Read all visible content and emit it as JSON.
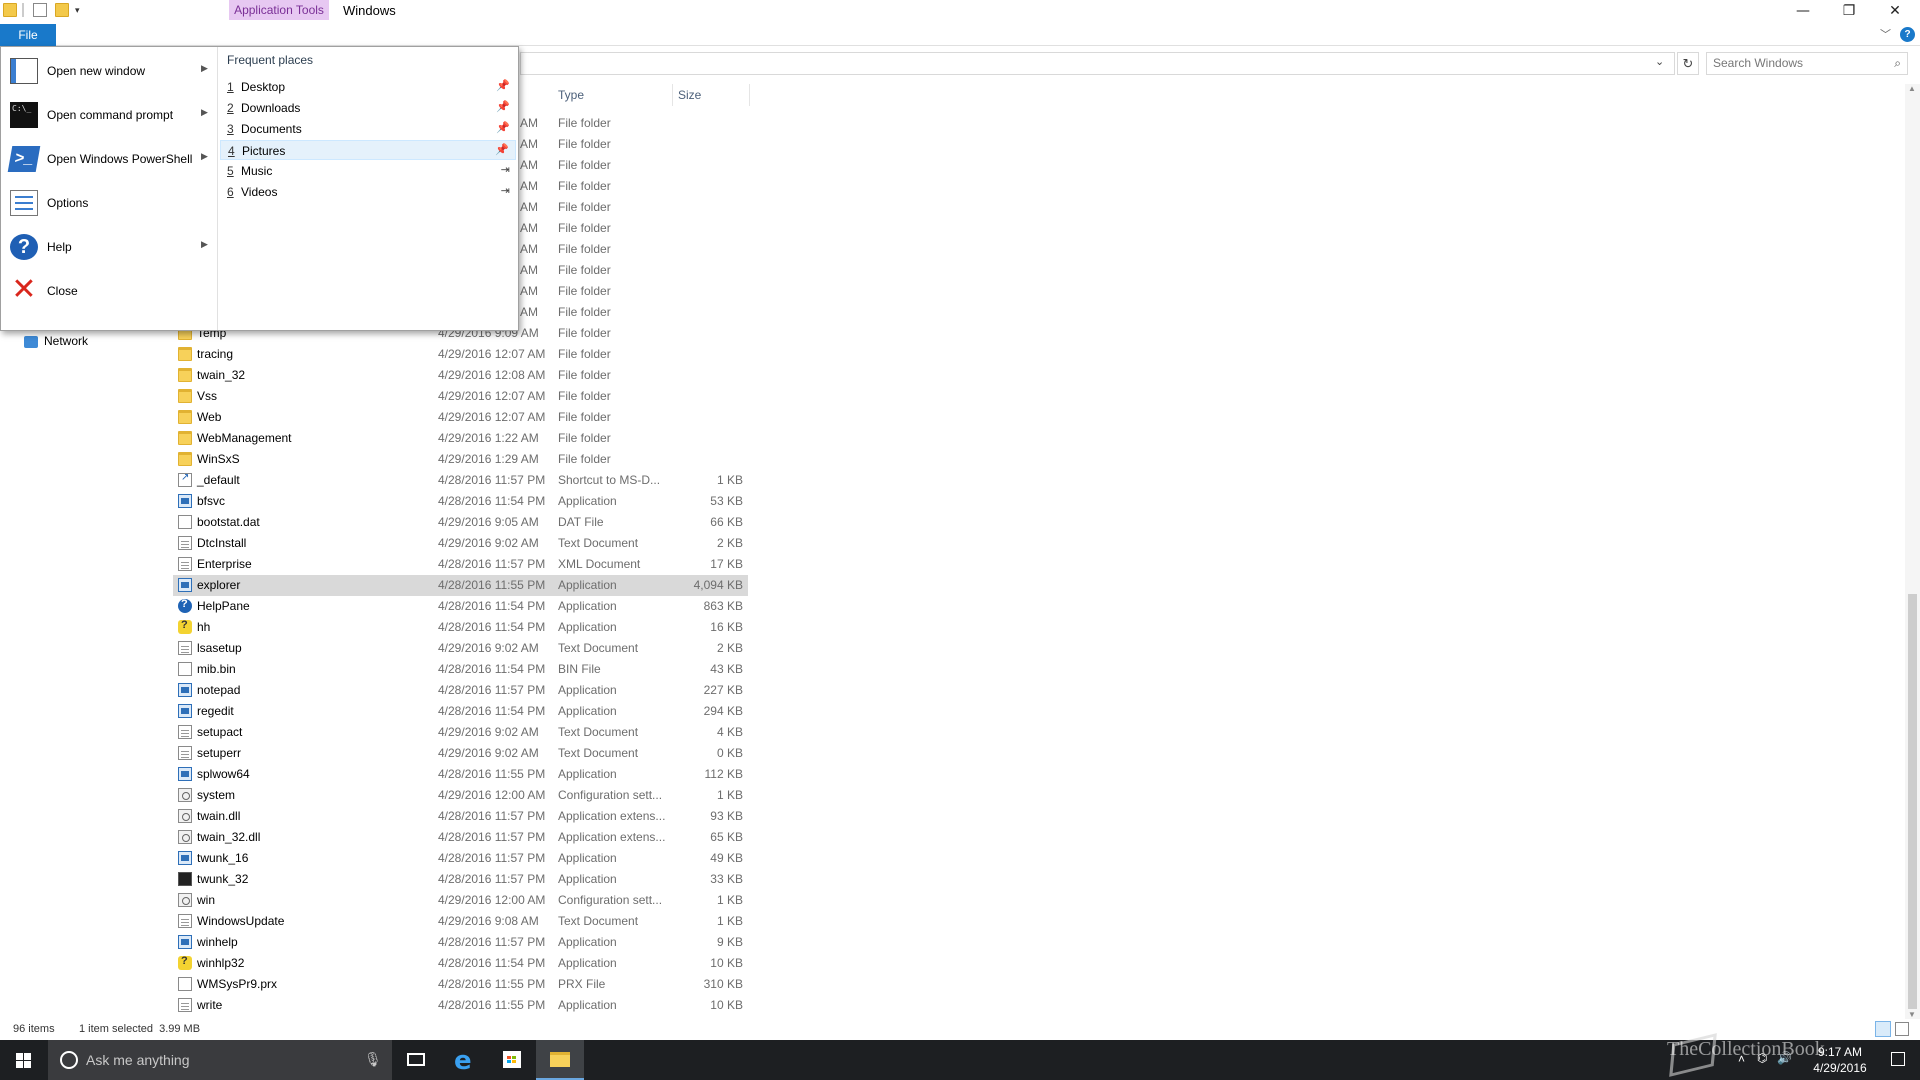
{
  "window": {
    "title": "Windows",
    "contextual_tab": "Application Tools",
    "minimize": "—",
    "maximize": "❐",
    "close": "✕"
  },
  "ribbon": {
    "file_tab": "File",
    "collapse": "﹀",
    "help": "?"
  },
  "address": {
    "search_placeholder": "Search Windows",
    "dropdown": "⌄",
    "refresh": "↻",
    "search_icon": "🔍"
  },
  "columns": {
    "type": "Type",
    "size": "Size"
  },
  "nav": {
    "network": "Network"
  },
  "file_menu": {
    "items": [
      {
        "label": "Open new window",
        "icon": "new-window-icon",
        "submenu": true
      },
      {
        "label": "Open command prompt",
        "icon": "command-prompt-icon",
        "submenu": true
      },
      {
        "label": "Open Windows PowerShell",
        "icon": "powershell-icon",
        "submenu": true
      },
      {
        "label": "Options",
        "icon": "options-icon",
        "submenu": false
      },
      {
        "label": "Help",
        "icon": "help-icon",
        "submenu": true
      },
      {
        "label": "Close",
        "icon": "close-icon",
        "submenu": false
      }
    ],
    "frequent_title": "Frequent places",
    "frequent": [
      {
        "num": "1",
        "label": "Desktop",
        "pinned": true
      },
      {
        "num": "2",
        "label": "Downloads",
        "pinned": true
      },
      {
        "num": "3",
        "label": "Documents",
        "pinned": true
      },
      {
        "num": "4",
        "label": "Pictures",
        "pinned": true
      },
      {
        "num": "5",
        "label": "Music",
        "pinned": false
      },
      {
        "num": "6",
        "label": "Videos",
        "pinned": false
      }
    ]
  },
  "hidden_rows": [
    {
      "date_tail": "AM",
      "type": "File folder"
    },
    {
      "date_tail": "AM",
      "type": "File folder"
    },
    {
      "date_tail": "AM",
      "type": "File folder"
    },
    {
      "date_tail": "AM",
      "type": "File folder"
    },
    {
      "date_tail": "AM",
      "type": "File folder"
    },
    {
      "date_tail": "AM",
      "type": "File folder"
    },
    {
      "date_tail": "AM",
      "type": "File folder"
    },
    {
      "date_tail": "AM",
      "type": "File folder"
    },
    {
      "date_tail": "AM",
      "type": "File folder"
    },
    {
      "date_tail": "AM",
      "type": "File folder"
    }
  ],
  "files": [
    {
      "name": "Temp",
      "date": "4/29/2016 9:09 AM",
      "type": "File folder",
      "size": "",
      "icon": "folder"
    },
    {
      "name": "tracing",
      "date": "4/29/2016 12:07 AM",
      "type": "File folder",
      "size": "",
      "icon": "folder"
    },
    {
      "name": "twain_32",
      "date": "4/29/2016 12:08 AM",
      "type": "File folder",
      "size": "",
      "icon": "folder"
    },
    {
      "name": "Vss",
      "date": "4/29/2016 12:07 AM",
      "type": "File folder",
      "size": "",
      "icon": "folder"
    },
    {
      "name": "Web",
      "date": "4/29/2016 12:07 AM",
      "type": "File folder",
      "size": "",
      "icon": "folder"
    },
    {
      "name": "WebManagement",
      "date": "4/29/2016 1:22 AM",
      "type": "File folder",
      "size": "",
      "icon": "folder"
    },
    {
      "name": "WinSxS",
      "date": "4/29/2016 1:29 AM",
      "type": "File folder",
      "size": "",
      "icon": "folder"
    },
    {
      "name": "_default",
      "date": "4/28/2016 11:57 PM",
      "type": "Shortcut to MS-D...",
      "size": "1 KB",
      "icon": "shortcut"
    },
    {
      "name": "bfsvc",
      "date": "4/28/2016 11:54 PM",
      "type": "Application",
      "size": "53 KB",
      "icon": "app"
    },
    {
      "name": "bootstat.dat",
      "date": "4/29/2016 9:05 AM",
      "type": "DAT File",
      "size": "66 KB",
      "icon": "blank"
    },
    {
      "name": "DtcInstall",
      "date": "4/29/2016 9:02 AM",
      "type": "Text Document",
      "size": "2 KB",
      "icon": "doc"
    },
    {
      "name": "Enterprise",
      "date": "4/28/2016 11:57 PM",
      "type": "XML Document",
      "size": "17 KB",
      "icon": "doc"
    },
    {
      "name": "explorer",
      "date": "4/28/2016 11:55 PM",
      "type": "Application",
      "size": "4,094 KB",
      "icon": "app",
      "selected": true
    },
    {
      "name": "HelpPane",
      "date": "4/28/2016 11:54 PM",
      "type": "Application",
      "size": "863 KB",
      "icon": "help"
    },
    {
      "name": "hh",
      "date": "4/28/2016 11:54 PM",
      "type": "Application",
      "size": "16 KB",
      "icon": "yellowhelp"
    },
    {
      "name": "lsasetup",
      "date": "4/29/2016 9:02 AM",
      "type": "Text Document",
      "size": "2 KB",
      "icon": "doc"
    },
    {
      "name": "mib.bin",
      "date": "4/28/2016 11:54 PM",
      "type": "BIN File",
      "size": "43 KB",
      "icon": "blank"
    },
    {
      "name": "notepad",
      "date": "4/28/2016 11:57 PM",
      "type": "Application",
      "size": "227 KB",
      "icon": "app"
    },
    {
      "name": "regedit",
      "date": "4/28/2016 11:54 PM",
      "type": "Application",
      "size": "294 KB",
      "icon": "app"
    },
    {
      "name": "setupact",
      "date": "4/29/2016 9:02 AM",
      "type": "Text Document",
      "size": "4 KB",
      "icon": "doc"
    },
    {
      "name": "setuperr",
      "date": "4/29/2016 9:02 AM",
      "type": "Text Document",
      "size": "0 KB",
      "icon": "doc"
    },
    {
      "name": "splwow64",
      "date": "4/28/2016 11:55 PM",
      "type": "Application",
      "size": "112 KB",
      "icon": "app"
    },
    {
      "name": "system",
      "date": "4/29/2016 12:00 AM",
      "type": "Configuration sett...",
      "size": "1 KB",
      "icon": "cfg"
    },
    {
      "name": "twain.dll",
      "date": "4/28/2016 11:57 PM",
      "type": "Application extens...",
      "size": "93 KB",
      "icon": "cfg"
    },
    {
      "name": "twain_32.dll",
      "date": "4/28/2016 11:57 PM",
      "type": "Application extens...",
      "size": "65 KB",
      "icon": "cfg"
    },
    {
      "name": "twunk_16",
      "date": "4/28/2016 11:57 PM",
      "type": "Application",
      "size": "49 KB",
      "icon": "app"
    },
    {
      "name": "twunk_32",
      "date": "4/28/2016 11:57 PM",
      "type": "Application",
      "size": "33 KB",
      "icon": "dark"
    },
    {
      "name": "win",
      "date": "4/29/2016 12:00 AM",
      "type": "Configuration sett...",
      "size": "1 KB",
      "icon": "cfg"
    },
    {
      "name": "WindowsUpdate",
      "date": "4/29/2016 9:08 AM",
      "type": "Text Document",
      "size": "1 KB",
      "icon": "doc"
    },
    {
      "name": "winhelp",
      "date": "4/28/2016 11:57 PM",
      "type": "Application",
      "size": "9 KB",
      "icon": "app"
    },
    {
      "name": "winhlp32",
      "date": "4/28/2016 11:54 PM",
      "type": "Application",
      "size": "10 KB",
      "icon": "yellowhelp"
    },
    {
      "name": "WMSysPr9.prx",
      "date": "4/28/2016 11:55 PM",
      "type": "PRX File",
      "size": "310 KB",
      "icon": "blank"
    },
    {
      "name": "write",
      "date": "4/28/2016 11:55 PM",
      "type": "Application",
      "size": "10 KB",
      "icon": "doc"
    }
  ],
  "status": {
    "items": "96 items",
    "selected": "1 item selected  3.99 MB"
  },
  "taskbar": {
    "search_placeholder": "Ask me anything",
    "time": "9:17 AM",
    "date": "4/29/2016",
    "watermark": "TheCollectionBook"
  },
  "colors": {
    "accent": "#1979ca",
    "selection": "#d9d9d9",
    "app_tools": "#e7c8f2"
  }
}
